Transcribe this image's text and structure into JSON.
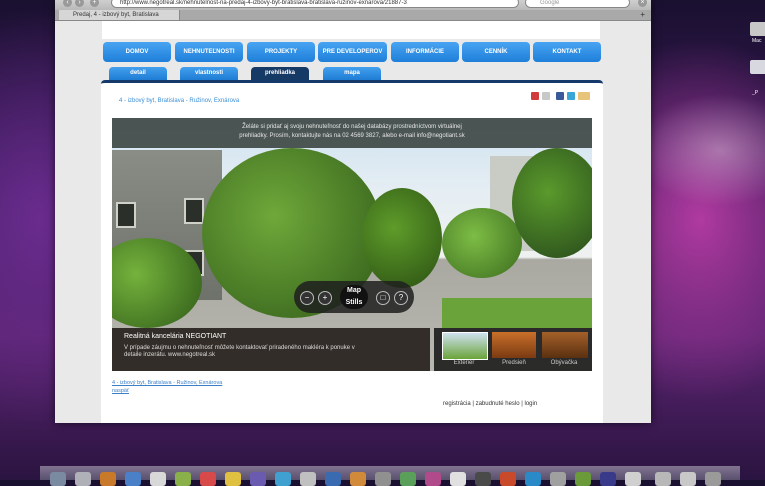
{
  "browser": {
    "url": "http://www.negotreal.sk/nehnutelnost-na-predaj-4-izbovy-byt-bratislava-bratislava-ruzinov-exnarova/21887-3",
    "search_placeholder": "Google",
    "tab_title": "Predaj, 4 - izbový byt, Bratislava",
    "new_tab": "+"
  },
  "menu": {
    "items": [
      "DOMOV",
      "NEHNUTEĽNOSTI",
      "PROJEKTY",
      "PRE DEVELOPEROV",
      "INFORMÁCIE",
      "CENNÍK",
      "KONTAKT"
    ]
  },
  "subtabs": {
    "items": [
      "detail",
      "vlastnosti",
      "prehliadka",
      "mapa"
    ],
    "active": "prehliadka"
  },
  "page": {
    "title": "4 - izbový byt, Bratislava - Ružinov, Exnárova"
  },
  "pano": {
    "banner_line1": "Želáte si pridať aj svoju nehnuteľnosť do našej databázy prostredníctvom virtuálnej",
    "banner_line2": "prehliadky. Prosím, kontaktujte nás na 02 4569 3827, alebo e-mail info@negotiant.sk",
    "map_label": "Map",
    "stills_label": "Stills",
    "minus": "−",
    "plus": "+",
    "help": "?",
    "info_title": "Realitná kancelária NEGOTIANT",
    "info_body": "V prípade záujmu o nehnuteľnosť môžete kontaktovať priradeného makléra k ponuke v detaile inzerátu. www.negotreal.sk",
    "thumbs": [
      "Exteriér",
      "Predsieň",
      "Obývačka"
    ]
  },
  "links": {
    "title": "4 - izbový byt, Bratislava - Ružinov, Exnárova",
    "back": "naspäť"
  },
  "footer": {
    "text": "registrácia | zabudnuté heslo | login"
  },
  "desktop": {
    "icon1": "Mac",
    "icon2": "_P"
  }
}
